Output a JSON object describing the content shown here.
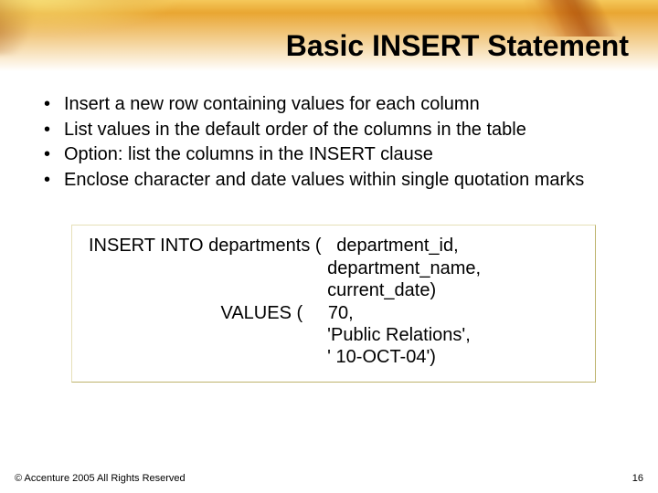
{
  "slide": {
    "title": "Basic INSERT Statement",
    "bullets": [
      "Insert a new row containing values for each column",
      "List values in the default order of the columns in the table",
      "Option: list the columns in the INSERT clause",
      "Enclose character and date values within single quotation marks"
    ],
    "code": "INSERT INTO departments (   department_id,\n                                               department_name,\n                                               current_date)\n                          VALUES (     70,\n                                               'Public Relations',\n                                               ' 10-OCT-04')",
    "footer": "© Accenture 2005 All Rights Reserved",
    "page_number": "16"
  }
}
